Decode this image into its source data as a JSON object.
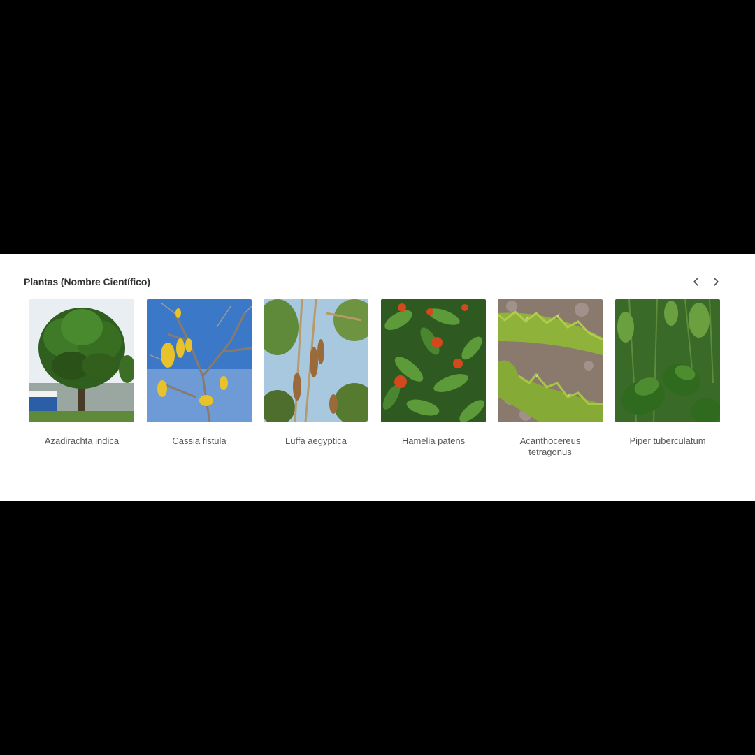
{
  "section": {
    "title": "Plantas (Nombre Científico)"
  },
  "nav": {
    "prev_icon": "chevron-left-icon",
    "next_icon": "chevron-right-icon"
  },
  "plants": [
    {
      "name": "Azadirachta indica"
    },
    {
      "name": "Cassia fistula"
    },
    {
      "name": "Luffa aegyptica"
    },
    {
      "name": "Hamelia patens"
    },
    {
      "name": "Acanthocereus tetragonus"
    },
    {
      "name": "Piper tuberculatum"
    }
  ]
}
